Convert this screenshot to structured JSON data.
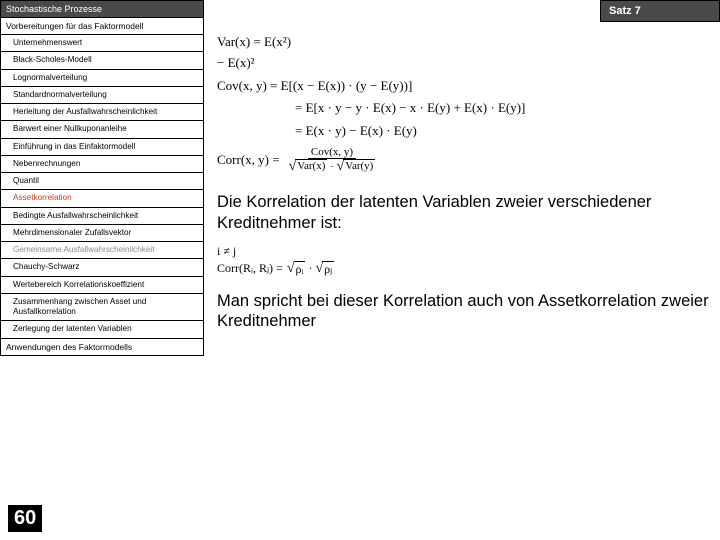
{
  "sidebar": {
    "header": "Stochastische Prozesse",
    "sub": "Vorbereitungen für das Faktormodell",
    "items": [
      {
        "label": "Unternehmenswert",
        "style": ""
      },
      {
        "label": "Black-Scholes-Modell",
        "style": ""
      },
      {
        "label": "Lognormalverteilung",
        "style": ""
      },
      {
        "label": "Standardnormalverteilung",
        "style": ""
      },
      {
        "label": "Herleitung der Ausfallwahrscheinlichkeit",
        "style": ""
      },
      {
        "label": "Barwert einer Nullkuponanleihe",
        "style": ""
      },
      {
        "label": "Einführung in das Einfaktormodell",
        "style": ""
      },
      {
        "label": "Nebenrechnungen",
        "style": ""
      },
      {
        "label": "Quantil",
        "style": ""
      },
      {
        "label": "Assetkorrelation",
        "style": "active"
      },
      {
        "label": "Bedingte Ausfallwahrscheinlichkeit",
        "style": ""
      },
      {
        "label": "Mehrdimensionaler Zufallsvektor",
        "style": ""
      },
      {
        "label": "Gemeinsame Ausfallwahrscheinlichkeit",
        "style": "dim"
      },
      {
        "label": "Chauchy-Schwarz",
        "style": ""
      },
      {
        "label": "Wertebereich Korrelationskoeffizient",
        "style": ""
      },
      {
        "label": "Zusammenhang zwischen Asset und Ausfallkorrelation",
        "style": ""
      },
      {
        "label": "Zerlegung der latenten Variablen",
        "style": ""
      }
    ],
    "footer": "Anwendungen des Faktormodells",
    "pagenum": "60"
  },
  "satz": "Satz 7",
  "equations": {
    "var": "Var(x) = E(x²) − E(x)²",
    "cov1": "Cov(x, y) = E[(x − E(x)) · (y − E(y))]",
    "cov2": "= E[x · y − y · E(x) − x · E(y) + E(x) · E(y)]",
    "cov3": "= E(x · y) − E(x) · E(y)",
    "corr_lead": "Corr(x, y) =",
    "corr_num": "Cov(x, y)",
    "corr_den_a": "Var(x)",
    "corr_den_b": "Var(y)"
  },
  "para1": "Die Korrelation der latenten Variablen zweier verschiedener Kreditnehmer ist:",
  "eq2": {
    "cond": "i ≠ j",
    "lead": "Corr(Rᵢ, Rⱼ) =",
    "a": "ρᵢ",
    "b": "ρⱼ"
  },
  "para2": "Man spricht bei dieser Korrelation auch von Assetkorrelation zweier Kreditnehmer"
}
